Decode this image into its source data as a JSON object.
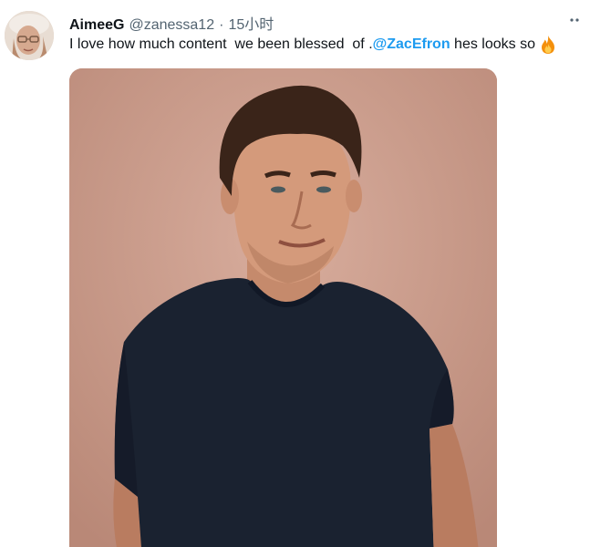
{
  "tweet": {
    "author": {
      "display_name": "AimeeG",
      "handle": "@zanessa12",
      "separator": "·",
      "time": "15小时",
      "avatar_icon": "avatar-photo"
    },
    "text": {
      "part1": "I love how much content  we been blessed  of .",
      "mention": "@ZacEfron",
      "part2": " hes looks so",
      "emoji_icon": "fire-icon"
    },
    "more_icon": "more-icon",
    "media": {
      "kind": "photo",
      "icon": "photo-man-dark-tshirt"
    }
  },
  "colors": {
    "text_primary": "#0f1419",
    "text_secondary": "#536471",
    "link": "#1d9bf0",
    "photo_background": "#c99f90"
  }
}
